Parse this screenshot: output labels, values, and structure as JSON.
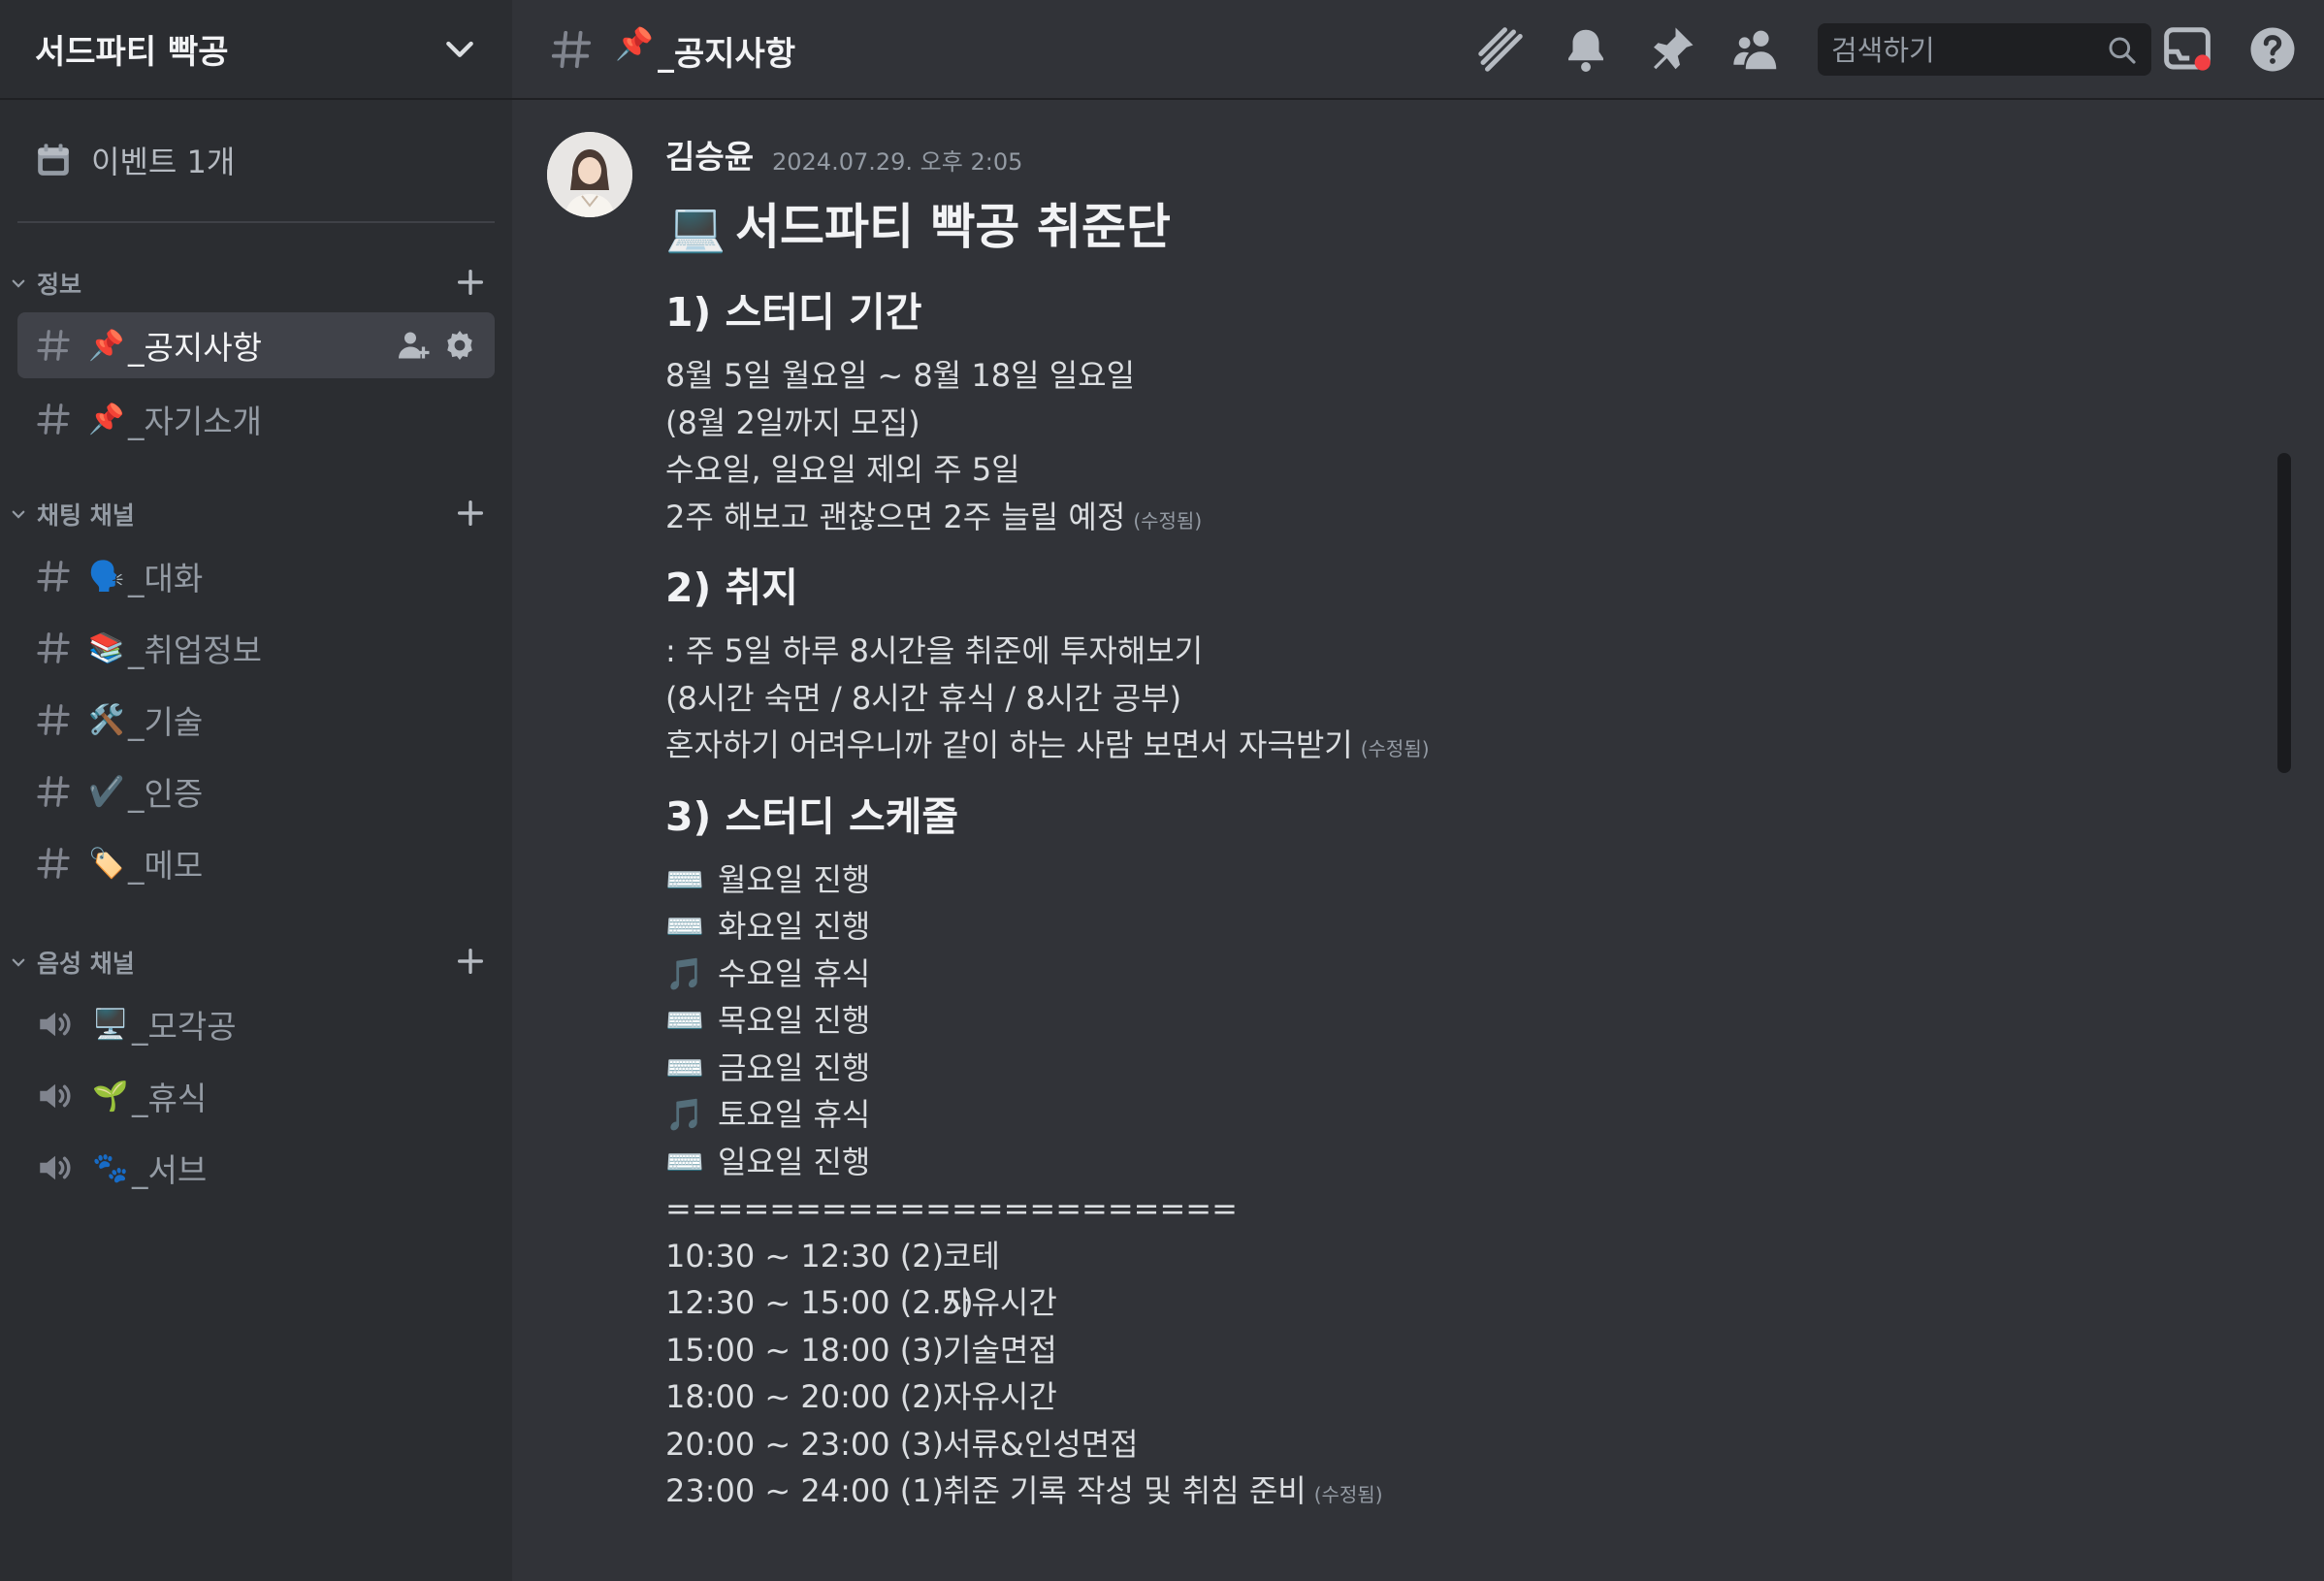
{
  "server": {
    "name": "서드파티 빡공"
  },
  "events": {
    "label": "이벤트 1개"
  },
  "categories": {
    "info": "정보",
    "text": "채팅 채널",
    "voice": "음성 채널"
  },
  "channels": {
    "info": [
      {
        "emoji": "📌",
        "name": "_공지사항"
      },
      {
        "emoji": "📌",
        "name": "_자기소개"
      }
    ],
    "text": [
      {
        "emoji": "🗣️",
        "name": "_대화"
      },
      {
        "emoji": "📚",
        "name": "_취업정보"
      },
      {
        "emoji": "🛠️",
        "name": "_기술"
      },
      {
        "emoji": "✔️",
        "name": "_인증"
      },
      {
        "emoji": "🏷️",
        "name": "_메모"
      }
    ],
    "voice": [
      {
        "emoji": "🖥️",
        "name": "_모각공"
      },
      {
        "emoji": "🌱",
        "name": "_휴식"
      },
      {
        "emoji": "🐾",
        "name": "_서브"
      }
    ]
  },
  "header": {
    "channel_emoji": "📌",
    "channel_name": "_공지사항",
    "search_placeholder": "검색하기"
  },
  "message": {
    "author": "김승윤",
    "timestamp": "2024.07.29. 오후 2:05",
    "title_emoji": "💻",
    "title": "서드파티 빡공 취준단",
    "edited_label": "(수정됨)",
    "sections": [
      {
        "heading": "1) 스터디 기간",
        "lines": [
          "8월 5일 월요일 ~ 8월 18일 일요일",
          "(8월 2일까지 모집)",
          "수요일, 일요일 제외 주 5일",
          "2주 해보고 괜찮으면 2주 늘릴 예정"
        ]
      },
      {
        "heading": "2) 취지",
        "lines": [
          ": 주 5일 하루 8시간을 취준에 투자해보기",
          "(8시간 숙면 / 8시간 휴식 / 8시간 공부)",
          "혼자하기 어려우니까 같이 하는 사람 보면서 자극받기"
        ]
      },
      {
        "heading": "3) 스터디 스케줄",
        "days": [
          {
            "emoji": "⌨️",
            "text": "월요일 진행"
          },
          {
            "emoji": "🎵",
            "text": "화요일 진행"
          },
          {
            "emoji": "🎵",
            "text": "수요일 휴식"
          },
          {
            "emoji": "⌨️",
            "text": "목요일 진행"
          },
          {
            "emoji": "⌨️",
            "text": "금요일 진행"
          },
          {
            "emoji": "🎵",
            "text": "토요일 휴식"
          },
          {
            "emoji": "⌨️",
            "text": "일요일 진행"
          }
        ],
        "separator": "======================",
        "schedule": [
          {
            "time": "10:30 ~ 12:30 (2)",
            "task": "코테"
          },
          {
            "time": "12:30 ~ 15:00 (2.5)",
            "task": "자유시간"
          },
          {
            "time": "15:00 ~ 18:00 (3)",
            "task": "기술면접"
          },
          {
            "time": "18:00 ~ 20:00 (2)",
            "task": "자유시간"
          },
          {
            "time": "20:00 ~ 23:00 (3)",
            "task": "서류&인성면접"
          },
          {
            "time": "23:00 ~ 24:00 (1)",
            "task": "취준 기록 작성 및 취침 준비"
          }
        ]
      }
    ]
  },
  "colors": {
    "background": "#313338",
    "sidebar": "#2b2d31",
    "active": "#404249",
    "text": "#dbdee1",
    "muted": "#949ba4"
  }
}
